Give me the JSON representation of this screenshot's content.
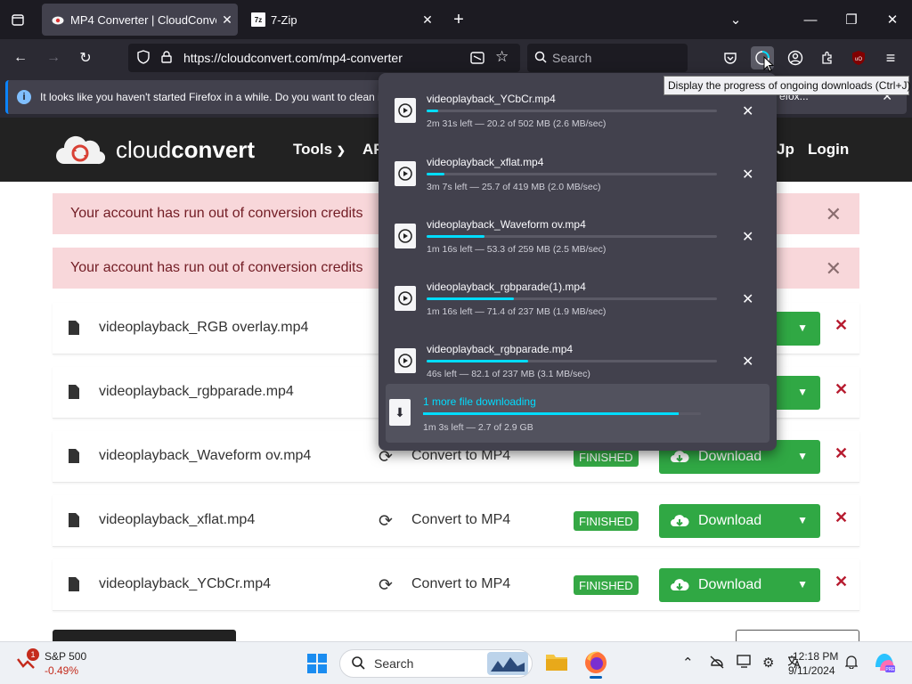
{
  "browser": {
    "tabs": [
      {
        "title": "MP4 Converter | CloudConvert",
        "active": true
      },
      {
        "title": "7-Zip",
        "active": false
      }
    ],
    "url": "https://cloudconvert.com/mp4-converter",
    "search_placeholder": "Search",
    "notification": "It looks like you haven't started Firefox in a while. Do you want to clean it",
    "notification_tail": "efox...",
    "tooltip": "Display the progress of ongoing downloads (Ctrl+J)"
  },
  "site": {
    "logo_light": "cloud",
    "logo_bold": "convert",
    "nav": {
      "tools": "Tools",
      "api": "AP",
      "signup_tail": "Jp",
      "login": "Login"
    }
  },
  "alerts": [
    "Your account has run out of conversion credits",
    "Your account has run out of conversion credits"
  ],
  "files": [
    {
      "name": "videoplayback_RGB overlay.mp4",
      "convert": "",
      "status": "",
      "download": ""
    },
    {
      "name": "videoplayback_rgbparade.mp4",
      "convert": "",
      "status": "",
      "download": ""
    },
    {
      "name": "videoplayback_Waveform ov.mp4",
      "convert": "Convert to MP4",
      "status": "FINISHED",
      "download": "Download"
    },
    {
      "name": "videoplayback_xflat.mp4",
      "convert": "Convert to MP4",
      "status": "FINISHED",
      "download": "Download"
    },
    {
      "name": "videoplayback_YCbCr.mp4",
      "convert": "Convert to MP4",
      "status": "FINISHED",
      "download": "Download"
    }
  ],
  "downloads": [
    {
      "name": "videoplayback_YCbCr.mp4",
      "status": "2m 31s left — 20.2 of 502 MB (2.6 MB/sec)",
      "progress": 0.04
    },
    {
      "name": "videoplayback_xflat.mp4",
      "status": "3m 7s left — 25.7 of 419 MB (2.0 MB/sec)",
      "progress": 0.06
    },
    {
      "name": "videoplayback_Waveform ov.mp4",
      "status": "1m 16s left — 53.3 of 259 MB (2.5 MB/sec)",
      "progress": 0.2
    },
    {
      "name": "videoplayback_rgbparade(1).mp4",
      "status": "1m 16s left — 71.4 of 237 MB (1.9 MB/sec)",
      "progress": 0.3
    },
    {
      "name": "videoplayback_rgbparade.mp4",
      "status": "46s left — 82.1 of 237 MB (3.1 MB/sec)",
      "progress": 0.35
    }
  ],
  "downloads_more": {
    "label": "1 more file downloading",
    "status": "1m 3s left — 2.7 of 2.9 GB",
    "progress": 0.92
  },
  "taskbar": {
    "stock_name": "S&P 500",
    "stock_change": "-0.49%",
    "stock_badge": "1",
    "search_placeholder": "Search",
    "time": "12:18 PM",
    "date": "9/11/2024"
  },
  "colors": {
    "accent_green": "#30a844",
    "progress_cyan": "#00ddff",
    "delete_red": "#b71c30"
  }
}
